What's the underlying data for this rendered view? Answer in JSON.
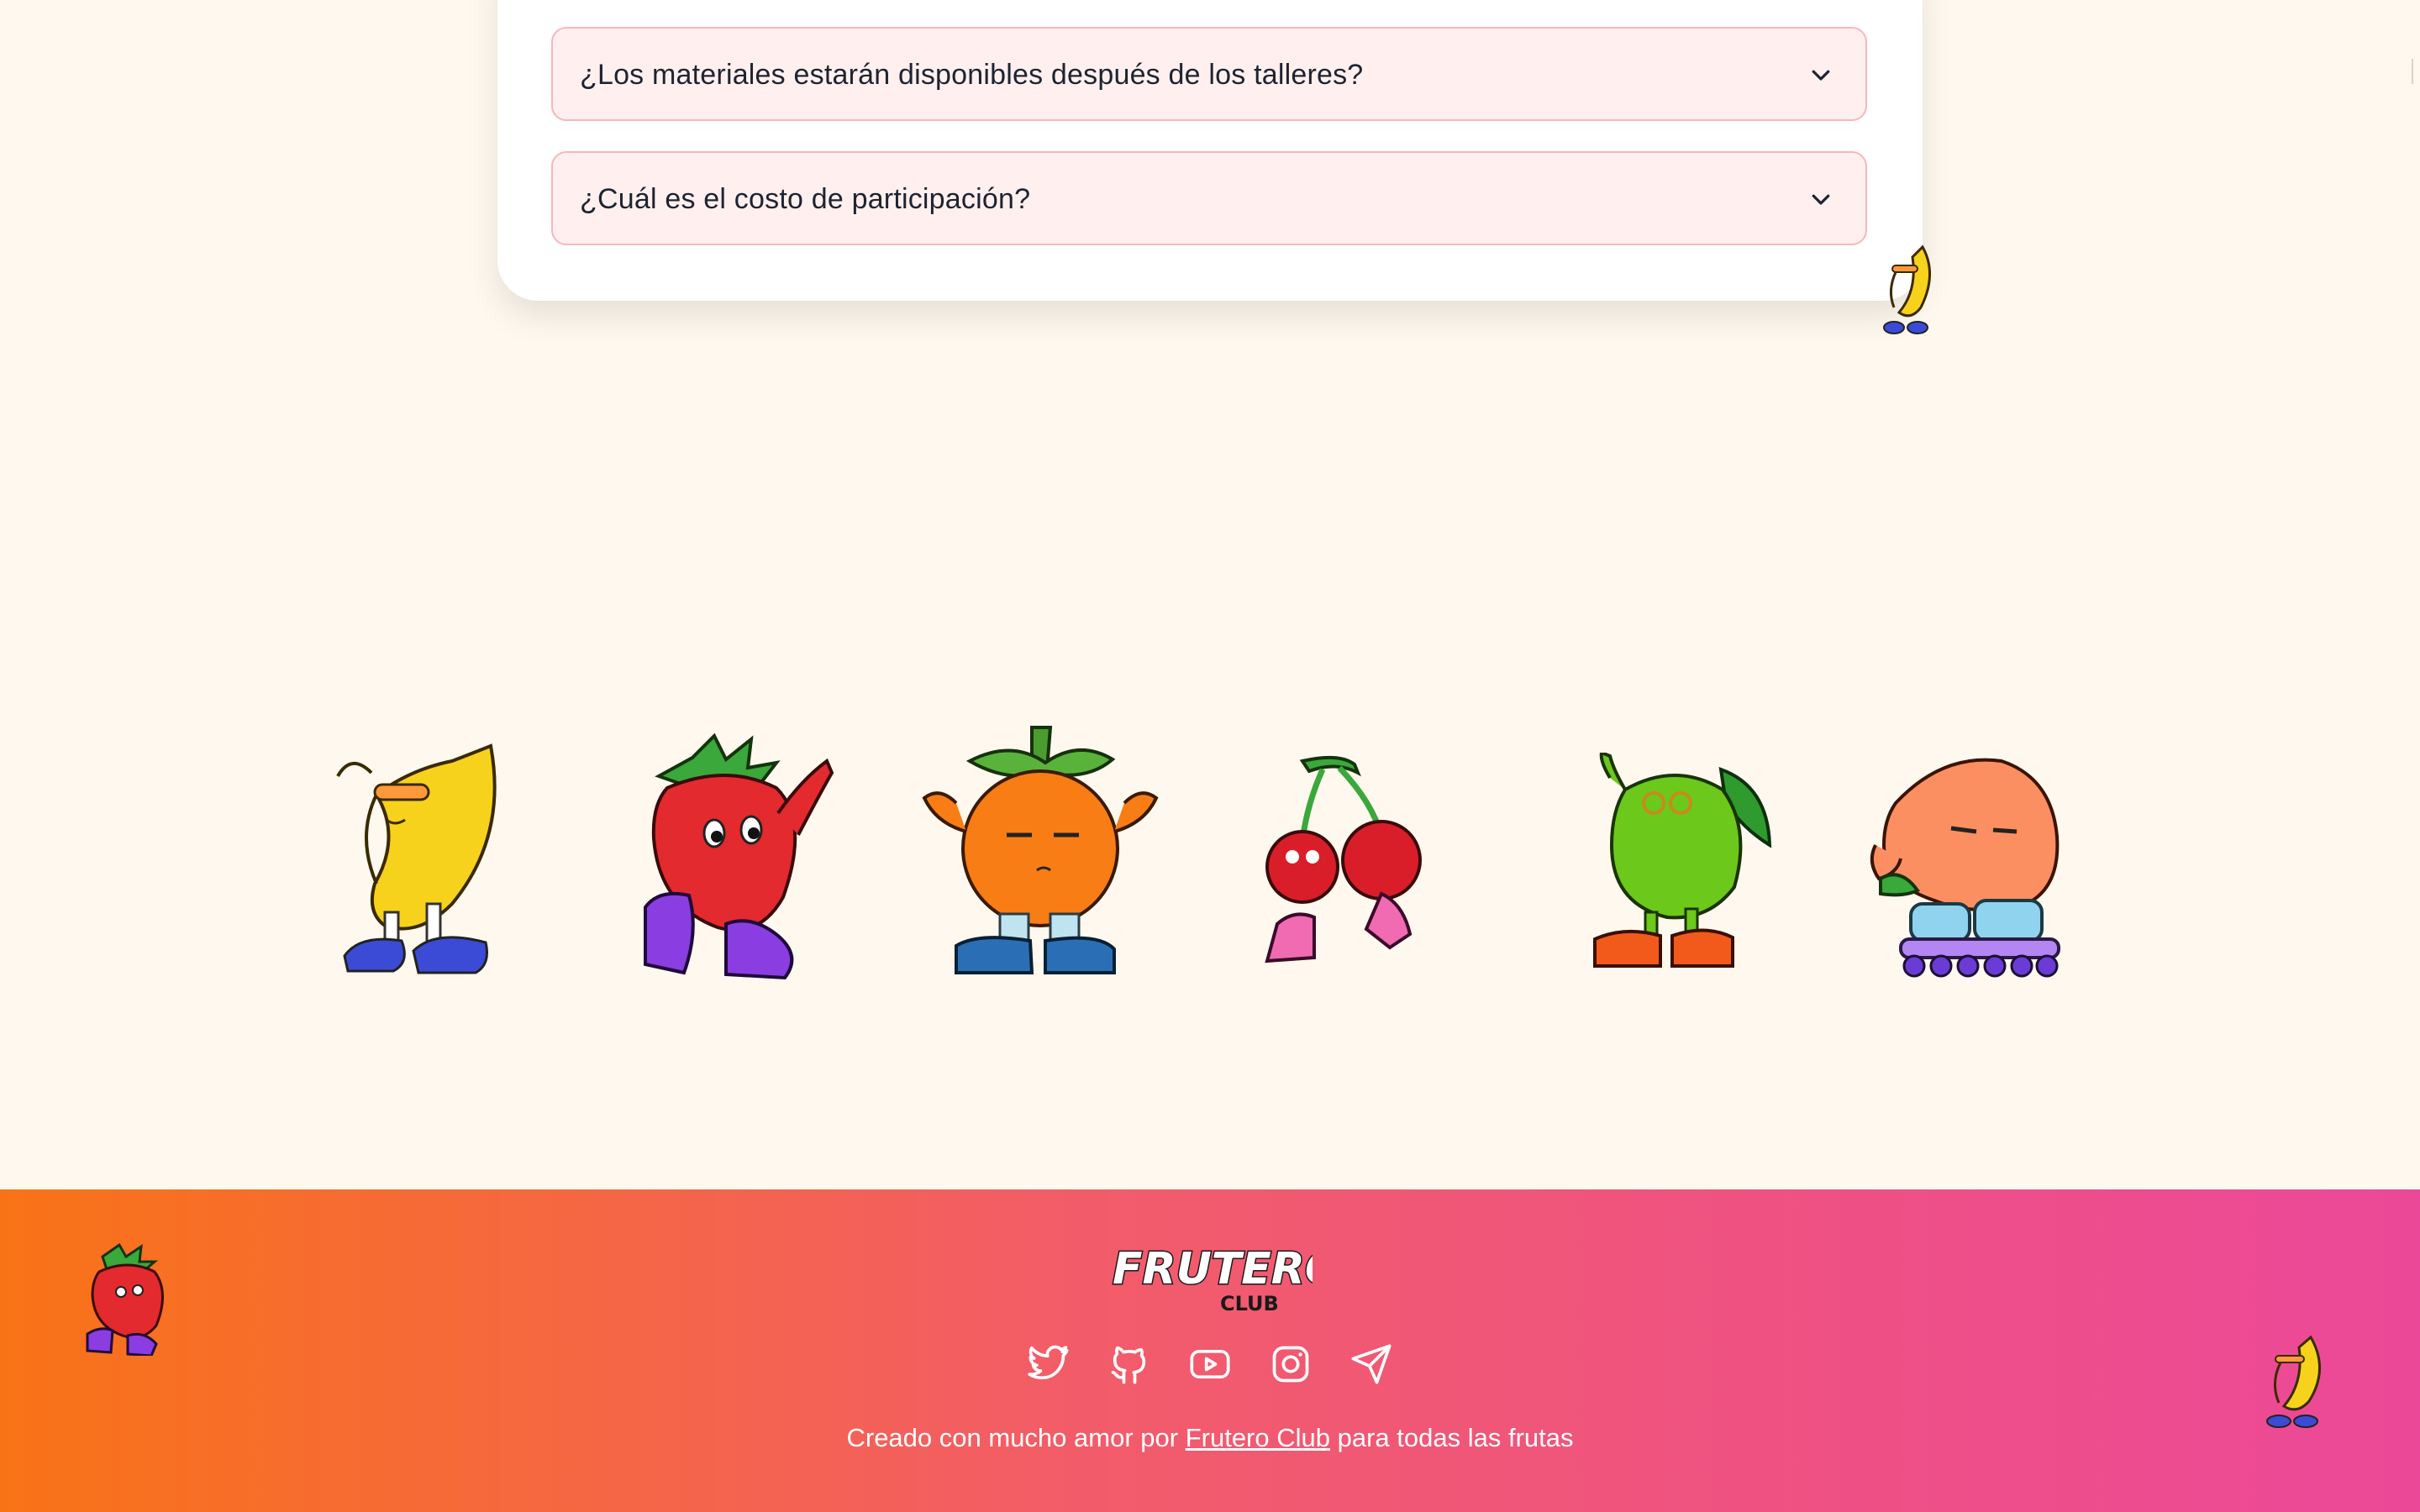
{
  "faq": {
    "items": [
      {
        "question": "¿Los materiales estarán disponibles después de los talleres?"
      },
      {
        "question": "¿Cuál es el costo de participación?"
      }
    ]
  },
  "mascots": [
    "banana",
    "strawberry",
    "orange",
    "cherries",
    "lime",
    "peach"
  ],
  "footer": {
    "logo_main": "FRUTERO",
    "logo_sub": "CLUB",
    "social": [
      "twitter-icon",
      "github-icon",
      "youtube-icon",
      "instagram-icon",
      "telegram-icon"
    ],
    "credit_prefix": "Creado con mucho amor por",
    "credit_link": "Frutero Club",
    "credit_suffix": "para todas las frutas"
  },
  "colors": {
    "page_bg": "#fff8ee",
    "faq_bg": "#fff0ef",
    "faq_border": "#f6b6bd",
    "footer_start": "#f97316",
    "footer_end": "#ec4899"
  }
}
